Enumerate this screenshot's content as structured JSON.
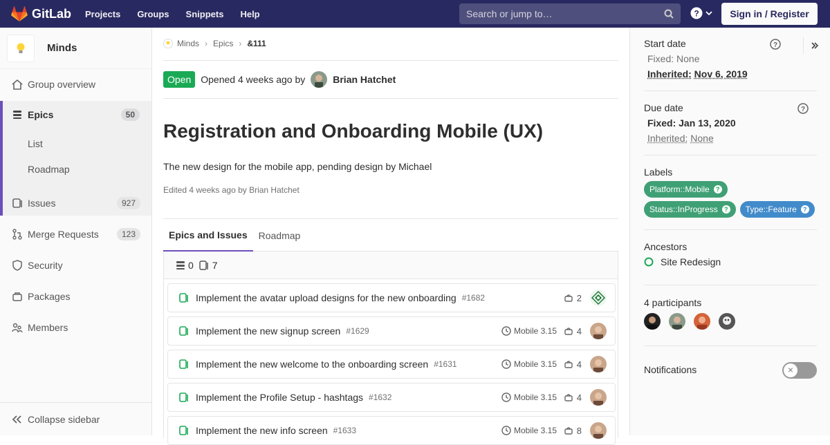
{
  "topbar": {
    "app_name": "GitLab",
    "nav": [
      "Projects",
      "Groups",
      "Snippets",
      "Help"
    ],
    "search_placeholder": "Search or jump to…",
    "signin_label": "Sign in / Register",
    "brand_color": "#292961"
  },
  "sidebar": {
    "group_name": "Minds",
    "items": [
      {
        "label": "Group overview",
        "icon": "home-icon"
      },
      {
        "label": "Epics",
        "icon": "epic-icon",
        "badge": "50"
      },
      {
        "label": "Issues",
        "icon": "issues-icon",
        "badge": "927"
      },
      {
        "label": "Merge Requests",
        "icon": "merge-request-icon",
        "badge": "123"
      },
      {
        "label": "Security",
        "icon": "shield-icon"
      },
      {
        "label": "Packages",
        "icon": "package-icon"
      },
      {
        "label": "Members",
        "icon": "users-icon"
      }
    ],
    "epics_subitems": [
      "List",
      "Roadmap"
    ],
    "collapse_label": "Collapse sidebar"
  },
  "breadcrumb": {
    "group": "Minds",
    "section": "Epics",
    "current": "&111"
  },
  "epic": {
    "status": "Open",
    "opened_text": "Opened 4 weeks ago by",
    "author": "Brian Hatchet",
    "title": "Registration and Onboarding Mobile (UX)",
    "description": "The new design for the mobile app, pending design by Michael",
    "edited_text": "Edited 4 weeks ago by Brian Hatchet"
  },
  "tabs": [
    "Epics and Issues",
    "Roadmap"
  ],
  "tree": {
    "epic_count": "0",
    "issue_count": "7",
    "rows": [
      {
        "title": "Implement the avatar upload designs for the new onboarding",
        "ref": "#1682",
        "milestone": "",
        "weight": "2",
        "avatar": "pattern"
      },
      {
        "title": "Implement the new signup screen",
        "ref": "#1629",
        "milestone": "Mobile 3.15",
        "weight": "4",
        "avatar": "person"
      },
      {
        "title": "Implement the new welcome to the onboarding screen",
        "ref": "#1631",
        "milestone": "Mobile 3.15",
        "weight": "4",
        "avatar": "person"
      },
      {
        "title": "Implement the Profile Setup - hashtags",
        "ref": "#1632",
        "milestone": "Mobile 3.15",
        "weight": "4",
        "avatar": "person"
      },
      {
        "title": "Implement the new info screen",
        "ref": "#1633",
        "milestone": "Mobile 3.15",
        "weight": "8",
        "avatar": "person"
      }
    ]
  },
  "right": {
    "start_date_title": "Start date",
    "start_fixed_label": "Fixed:",
    "start_fixed_value": "None",
    "start_inherited_label": "Inherited:",
    "start_inherited_value": "Nov 6, 2019",
    "due_date_title": "Due date",
    "due_fixed_label": "Fixed:",
    "due_fixed_value": "Jan 13, 2020",
    "due_inherited_label": "Inherited:",
    "due_inherited_value": "None",
    "labels_title": "Labels",
    "labels": [
      {
        "text": "Platform::Mobile",
        "color": "#40a075"
      },
      {
        "text": "Status::InProgress",
        "color": "#40a075"
      },
      {
        "text": "Type::Feature",
        "color": "#428bca"
      }
    ],
    "ancestors_title": "Ancestors",
    "ancestor": "Site Redesign",
    "participants_title": "4 participants",
    "notifications_title": "Notifications"
  }
}
